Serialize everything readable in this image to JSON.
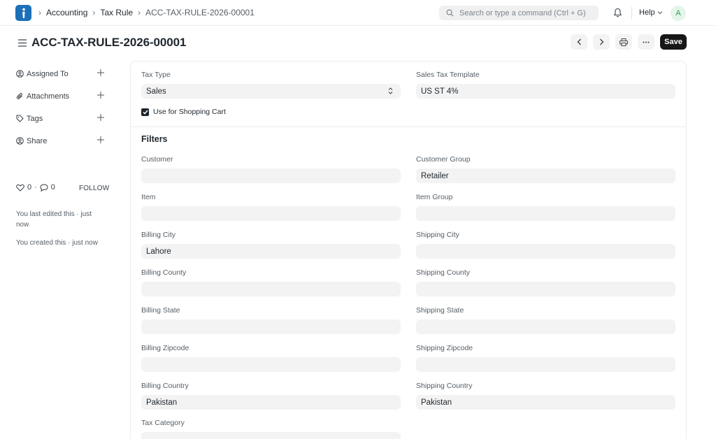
{
  "navbar": {
    "breadcrumbs": [
      "Accounting",
      "Tax Rule",
      "ACC-TAX-RULE-2026-00001"
    ],
    "search_placeholder": "Search or type a command (Ctrl + G)",
    "help_label": "Help",
    "avatar_initial": "A"
  },
  "page": {
    "title": "ACC-TAX-RULE-2026-00001",
    "save_label": "Save"
  },
  "sidebar": {
    "items": [
      {
        "label": "Assigned To",
        "icon": "assign-user-icon"
      },
      {
        "label": "Attachments",
        "icon": "paperclip-icon"
      },
      {
        "label": "Tags",
        "icon": "tag-icon"
      },
      {
        "label": "Share",
        "icon": "share-user-icon"
      }
    ],
    "likes_count": "0",
    "comments_count": "0",
    "follow_label": "FOLLOW",
    "activity": [
      "You last edited this · just now",
      "You created this · just now"
    ]
  },
  "form": {
    "tax_type": {
      "label": "Tax Type",
      "value": "Sales"
    },
    "sales_tax_template": {
      "label": "Sales Tax Template",
      "value": "US ST 4%"
    },
    "use_for_shopping_cart": {
      "label": "Use for Shopping Cart",
      "checked": true
    },
    "filters_title": "Filters",
    "fields": {
      "customer": {
        "label": "Customer",
        "value": ""
      },
      "customer_group": {
        "label": "Customer Group",
        "value": "Retailer"
      },
      "item": {
        "label": "Item",
        "value": ""
      },
      "item_group": {
        "label": "Item Group",
        "value": ""
      },
      "billing_city": {
        "label": "Billing City",
        "value": "Lahore"
      },
      "shipping_city": {
        "label": "Shipping City",
        "value": ""
      },
      "billing_county": {
        "label": "Billing County",
        "value": ""
      },
      "shipping_county": {
        "label": "Shipping County",
        "value": ""
      },
      "billing_state": {
        "label": "Billing State",
        "value": ""
      },
      "shipping_state": {
        "label": "Shipping State",
        "value": ""
      },
      "billing_zipcode": {
        "label": "Billing Zipcode",
        "value": ""
      },
      "shipping_zipcode": {
        "label": "Shipping Zipcode",
        "value": ""
      },
      "billing_country": {
        "label": "Billing Country",
        "value": "Pakistan"
      },
      "shipping_country": {
        "label": "Shipping Country",
        "value": "Pakistan"
      },
      "tax_category": {
        "label": "Tax Category",
        "value": ""
      }
    }
  },
  "colors": {
    "accent": "#171717",
    "logo": "#1d6fb8",
    "input_bg": "#f3f3f3"
  }
}
